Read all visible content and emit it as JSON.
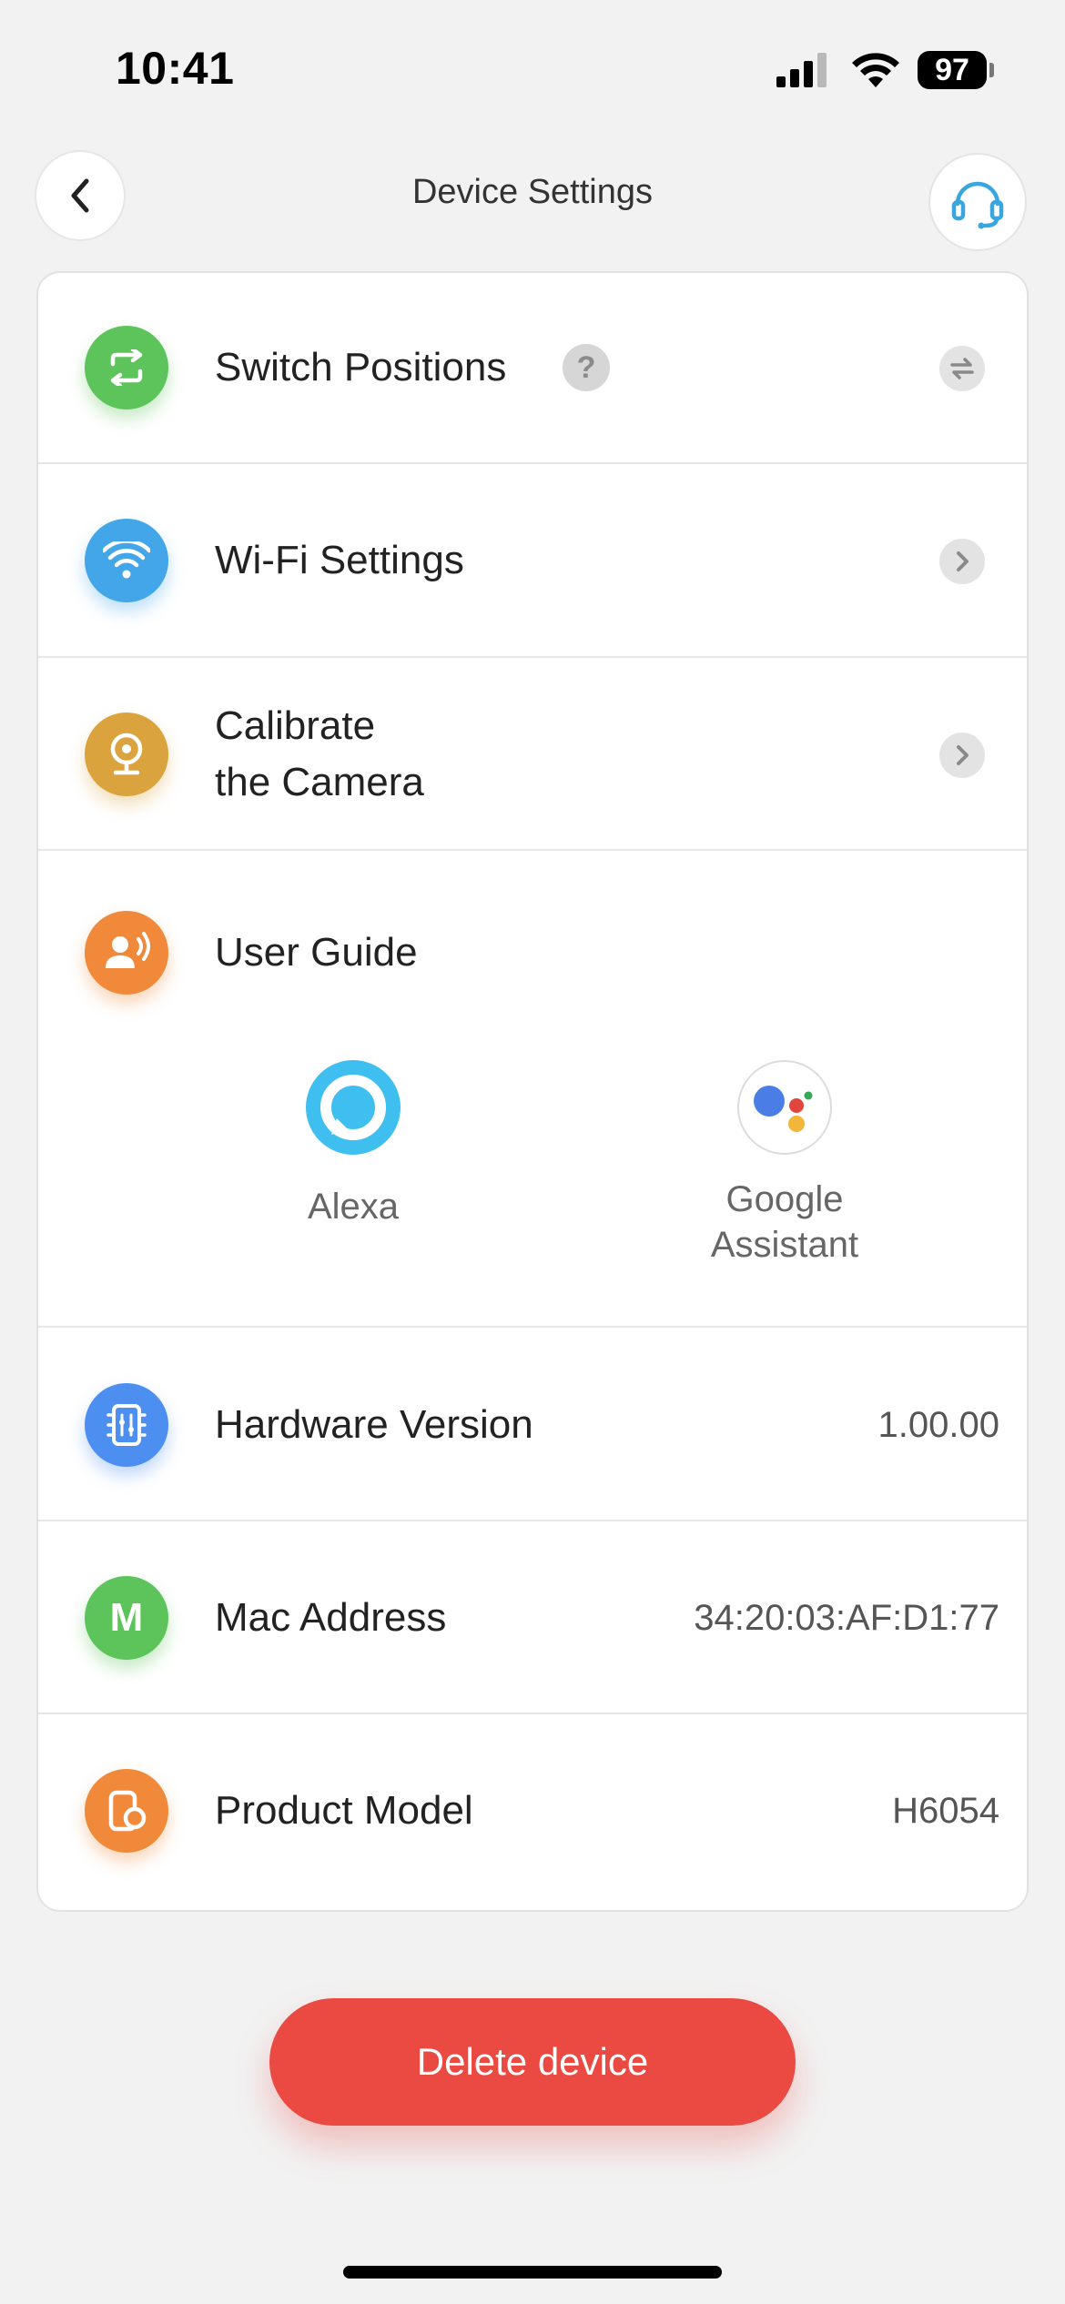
{
  "status_bar": {
    "time": "10:41",
    "battery": "97"
  },
  "header": {
    "title": "Device Settings"
  },
  "settings": {
    "switch_positions": "Switch Positions",
    "help_badge": "?",
    "wifi_settings": "Wi-Fi Settings",
    "calibrate_line1": "Calibrate",
    "calibrate_line2": "the Camera",
    "user_guide": "User Guide",
    "alexa": "Alexa",
    "google_line1": "Google",
    "google_line2": "Assistant",
    "hardware_version_label": "Hardware Version",
    "hardware_version_value": "1.00.00",
    "mac_address_label": "Mac Address",
    "mac_address_value": "34:20:03:AF:D1:77",
    "product_model_label": "Product Model",
    "product_model_value": "H6054",
    "mac_icon_letter": "M"
  },
  "actions": {
    "delete_label": "Delete device"
  },
  "colors": {
    "switch_icon": "#5cc45a",
    "wifi_icon": "#42a6e8",
    "camera_icon": "#dba33d",
    "guide_icon": "#f0893a",
    "hardware_icon": "#4d8ff0",
    "mac_icon": "#5cc45a",
    "model_icon": "#f0893a",
    "alexa": "#3fbfef",
    "delete": "#ea4a42"
  },
  "icons": {
    "switch_positions": "swap-arrows-icon",
    "wifi": "wifi-icon",
    "camera": "webcam-icon",
    "user_guide": "voice-user-icon",
    "hardware": "chip-icon",
    "mac": "letter-m-icon",
    "model": "device-icon"
  }
}
